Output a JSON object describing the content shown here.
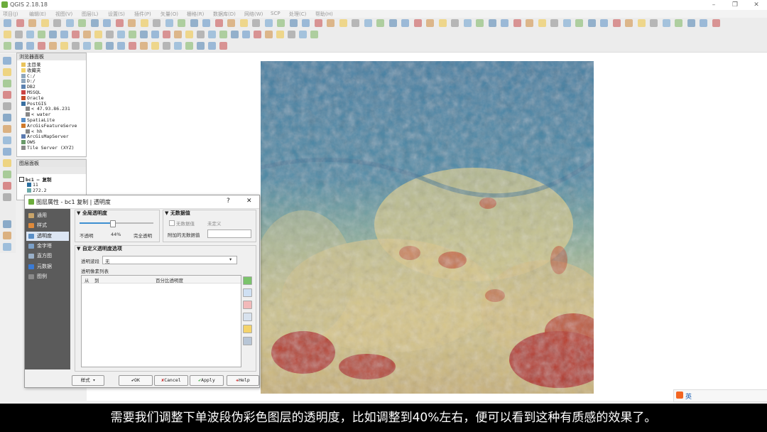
{
  "window": {
    "title": "QGIS 2.18.18"
  },
  "menubar": {
    "items": [
      "项目(J)",
      "编辑(E)",
      "视图(V)",
      "图层(L)",
      "设置(S)",
      "插件(P)",
      "矢量(O)",
      "栅格(R)",
      "数据库(D)",
      "网络(W)",
      "SCP",
      "处理(C)",
      "帮助(H)"
    ]
  },
  "browser_panel": {
    "title": "浏览器面板",
    "items": [
      "主目录",
      "收藏夹",
      "C:/",
      "D:/",
      "DB2",
      "MSSQL",
      "Oracle",
      "PostGIS",
      "< 47.93.86.231",
      "< water",
      "SpatiaLite",
      "ArcGisFeatureServe",
      "< hh",
      "ArcGisMapServer",
      "OWS",
      "Tile Server (XYZ)"
    ]
  },
  "layers_panel": {
    "title": "图层面板",
    "layer_name": "bc1 — 复制",
    "legend": [
      "11",
      "272.2"
    ]
  },
  "dialog": {
    "title": "图层属性 - bc1 复制 | 透明度",
    "help_glyph": "?",
    "close_glyph": "✕",
    "sidebar": [
      "通用",
      "样式",
      "透明度",
      "金字塔",
      "直方图",
      "元数据",
      "图例"
    ],
    "global_transparency": {
      "title": "全局透明度",
      "left_label": "不透明",
      "value_text": "44%",
      "right_label": "完全透明",
      "value_fraction": 0.44
    },
    "nodata": {
      "title": "无数据值",
      "checkbox_label": "无数据值",
      "undefined_text": "未定义",
      "extra_label": "附加的无数据值"
    },
    "custom": {
      "title": "自定义透明度选项",
      "band_label": "透明波段",
      "band_value": "无",
      "pixel_list_label": "透明像素列表",
      "col_from": "从",
      "col_to": "到",
      "col_percent": "百分比透明度"
    },
    "buttons": {
      "style": "样式",
      "ok": "OK",
      "cancel": "Cancel",
      "apply": "Apply",
      "help": "Help"
    }
  },
  "subtitle": "需要我们调整下单波段伪彩色图层的透明度，比如调整到40%左右，便可以看到这种有质感的效果了。",
  "ime": {
    "label": "英"
  },
  "colors": {
    "map_blue": "#3f7fa3",
    "map_yellow": "#dccd8f",
    "map_red": "#b0241c",
    "sidebar": "#5b5b5b"
  }
}
